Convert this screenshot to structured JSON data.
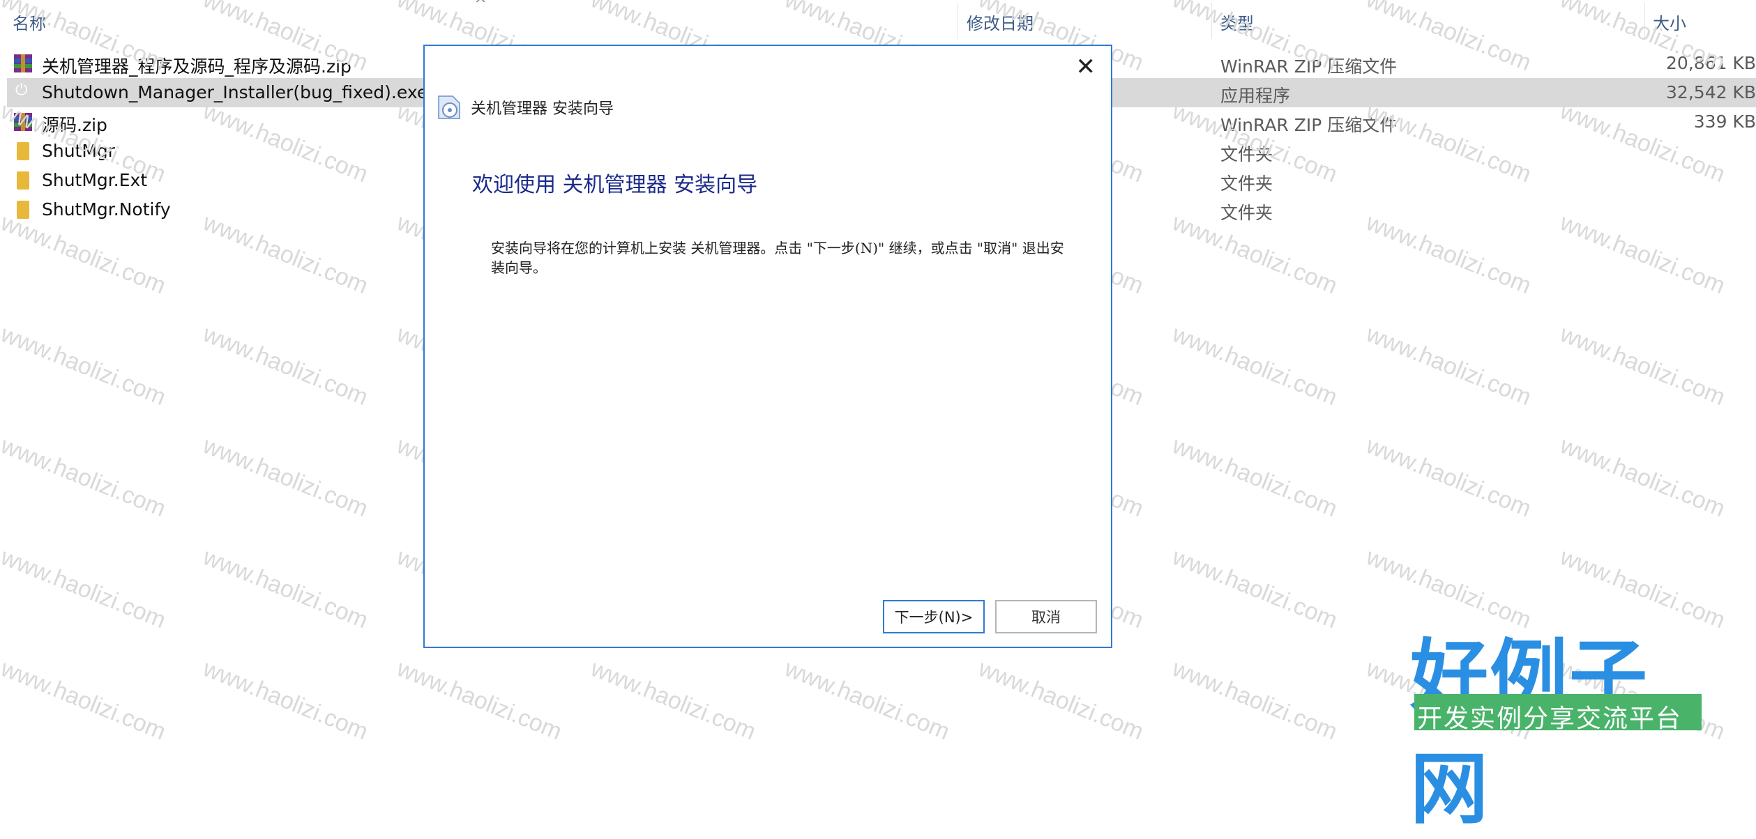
{
  "explorer": {
    "columns": {
      "name": "名称",
      "date": "修改日期",
      "type": "类型",
      "size": "大小"
    },
    "sort_indicator": "^",
    "files": [
      {
        "name": "关机管理器_程序及源码_程序及源码.zip",
        "type": "WinRAR ZIP 压缩文件",
        "size": "20,861 KB",
        "icon": "winrar-zip-icon",
        "selected": false
      },
      {
        "name": "Shutdown_Manager_Installer(bug_fixed).exe",
        "type": "应用程序",
        "size": "32,542 KB",
        "icon": "power-app-icon",
        "selected": true
      },
      {
        "name": "源码.zip",
        "type": "WinRAR ZIP 压缩文件",
        "size": "339 KB",
        "icon": "winrar-zip-icon",
        "selected": false
      },
      {
        "name": "ShutMgr",
        "type": "文件夹",
        "size": "",
        "icon": "folder-icon",
        "selected": false
      },
      {
        "name": "ShutMgr.Ext",
        "type": "文件夹",
        "size": "",
        "icon": "folder-icon",
        "selected": false
      },
      {
        "name": "ShutMgr.Notify",
        "type": "文件夹",
        "size": "",
        "icon": "folder-icon",
        "selected": false
      }
    ]
  },
  "dialog": {
    "title": "关机管理器 安装向导",
    "close_glyph": "✕",
    "heading": "欢迎使用 关机管理器 安装向导",
    "description": "安装向导将在您的计算机上安装 关机管理器。点击 \"下一步(N)\" 继续，或点击 \"取消\" 退出安装向导。",
    "next_button": "下一步(N)>",
    "cancel_button": "取消",
    "accent_color": "#2f7bd3",
    "heading_color": "#1a2a8a"
  },
  "watermark": {
    "text": "www.haolizi.com"
  },
  "logo": {
    "main": "好例子网",
    "tagline": "开发实例分享交流平台"
  }
}
